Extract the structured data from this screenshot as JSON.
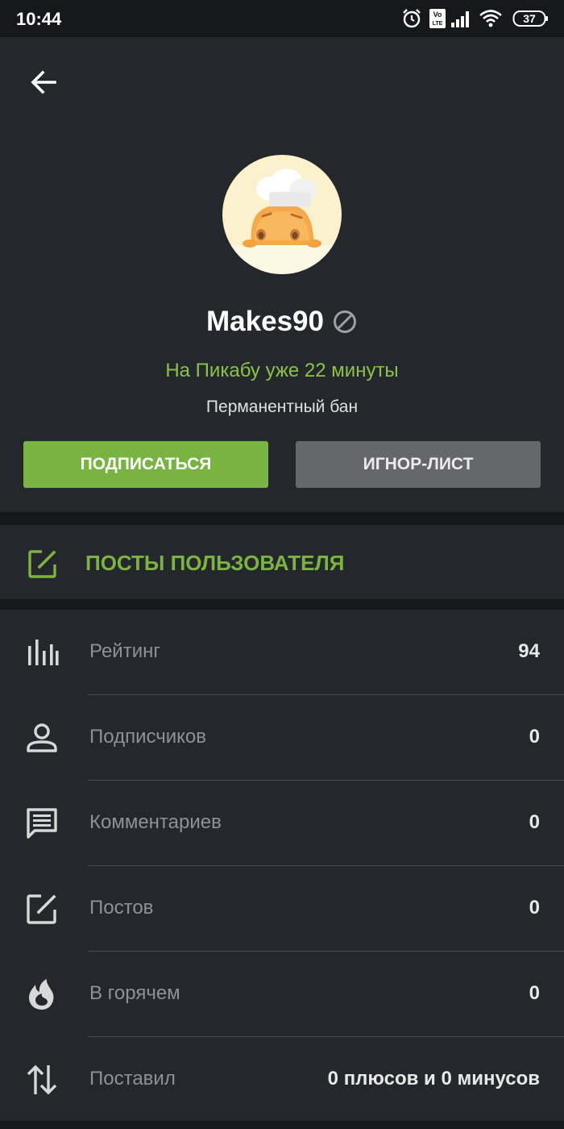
{
  "status_bar": {
    "time": "10:44",
    "battery": "37",
    "icons": [
      "alarm-icon",
      "volte-icon",
      "signal-icon",
      "wifi-icon",
      "battery-icon"
    ]
  },
  "header": {
    "back_icon": "arrow-left-icon"
  },
  "profile": {
    "avatar": "chef-avatar",
    "username": "Makes90",
    "ban_icon": "ban-icon",
    "on_site": "На Пикабу уже 22 минуты",
    "status": "Перманентный бан",
    "subscribe_label": "ПОДПИСАТЬСЯ",
    "ignore_label": "ИГНОР-ЛИСТ"
  },
  "posts_link": {
    "icon": "edit-icon",
    "label": "ПОСТЫ ПОЛЬЗОВАТЕЛЯ"
  },
  "stats": [
    {
      "icon": "bar-chart-icon",
      "label": "Рейтинг",
      "value": "94"
    },
    {
      "icon": "person-icon",
      "label": "Подписчиков",
      "value": "0"
    },
    {
      "icon": "comment-icon",
      "label": "Комментариев",
      "value": "0"
    },
    {
      "icon": "edit-icon",
      "label": "Постов",
      "value": "0"
    },
    {
      "icon": "fire-icon",
      "label": "В горячем",
      "value": "0"
    },
    {
      "icon": "sort-arrows-icon",
      "label": "Поставил",
      "value": "0 плюсов и 0 минусов"
    }
  ],
  "colors": {
    "background": "#16181b",
    "card": "#24272b",
    "accent_green": "#79b442",
    "button_grey": "#65676a"
  }
}
